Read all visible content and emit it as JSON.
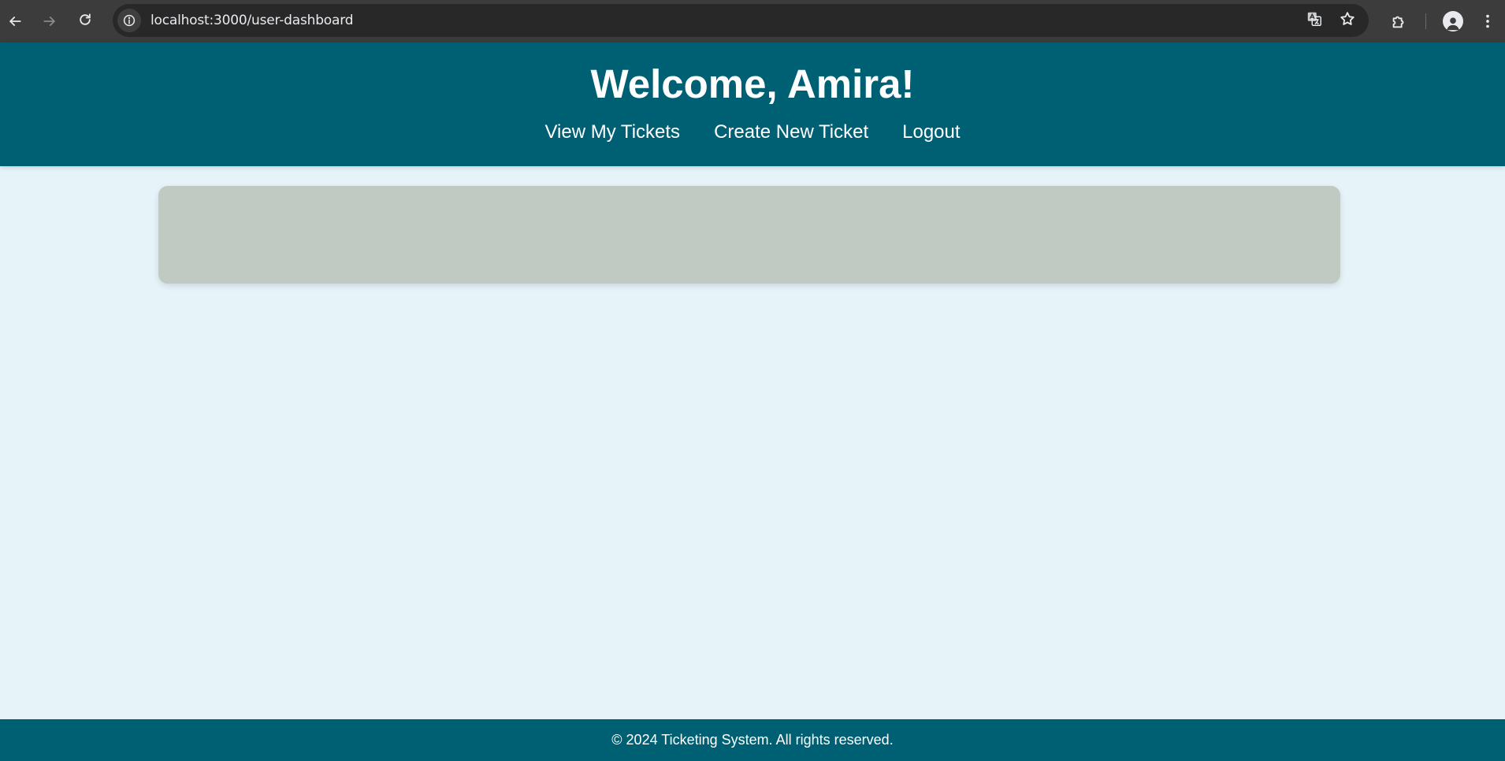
{
  "browser": {
    "url": "localhost:3000/user-dashboard",
    "icons": {
      "back": "arrow-left-icon",
      "forward": "arrow-right-icon",
      "reload": "reload-icon",
      "site_info": "info-icon",
      "translate": "translate-icon",
      "bookmark": "star-icon",
      "extensions": "puzzle-icon",
      "profile": "profile-icon",
      "menu": "kebab-menu-icon"
    }
  },
  "header": {
    "title": "Welcome, Amira!",
    "nav": [
      {
        "label": "View My Tickets"
      },
      {
        "label": "Create New Ticket"
      },
      {
        "label": "Logout"
      }
    ]
  },
  "footer": {
    "text": "© 2024 Ticketing System. All rights reserved."
  },
  "colors": {
    "header_bg": "#006073",
    "page_bg": "#e6f4fa",
    "card_bg": "#c0c9c2",
    "text_on_header": "#ffffff"
  }
}
